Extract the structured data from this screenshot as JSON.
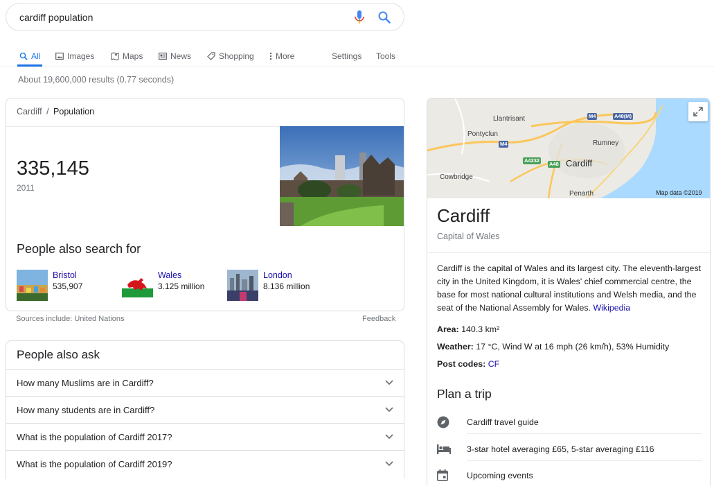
{
  "search": {
    "query": "cardiff population"
  },
  "tabs": {
    "all": "All",
    "images": "Images",
    "maps": "Maps",
    "news": "News",
    "shopping": "Shopping",
    "more": "More",
    "settings": "Settings",
    "tools": "Tools"
  },
  "stats": "About 19,600,000 results (0.77 seconds)",
  "population": {
    "breadcrumb_city": "Cardiff",
    "breadcrumb_sep": "/",
    "breadcrumb_topic": "Population",
    "value": "335,145",
    "year": "2011",
    "people_also_search_title": "People also search for",
    "related": [
      {
        "name": "Bristol",
        "value": "535,907"
      },
      {
        "name": "Wales",
        "value": "3.125 million"
      },
      {
        "name": "London",
        "value": "8.136 million"
      }
    ],
    "sources": "Sources include: United Nations",
    "feedback": "Feedback"
  },
  "people_also_ask": {
    "title": "People also ask",
    "questions": [
      "How many Muslims are in Cardiff?",
      "How many students are in Cardiff?",
      "What is the population of Cardiff 2017?",
      "What is the population of Cardiff 2019?"
    ]
  },
  "knowledge_panel": {
    "map": {
      "labels": [
        "Llantrisant",
        "Pontyclun",
        "Rumney",
        "Cardiff",
        "Cowbridge",
        "Penarth"
      ],
      "roads": [
        "M4",
        "A48(M)",
        "M4",
        "A4232",
        "A48"
      ],
      "attribution": "Map data ©2019"
    },
    "title": "Cardiff",
    "subtitle": "Capital of Wales",
    "description": "Cardiff is the capital of Wales and its largest city. The eleventh-largest city in the United Kingdom, it is Wales' chief commercial centre, the base for most national cultural institutions and Welsh media, and the seat of the National Assembly for Wales.",
    "description_link": "Wikipedia",
    "facts": {
      "area_label": "Area:",
      "area_value": "140.3 km²",
      "weather_label": "Weather:",
      "weather_value": "17 °C, Wind W at 16 mph (26 km/h), 53% Humidity",
      "postcodes_label": "Post codes:",
      "postcodes_value": "CF"
    },
    "plan_title": "Plan a trip",
    "plan_items": [
      "Cardiff travel guide",
      "3-star hotel averaging £65, 5-star averaging £116",
      "Upcoming events"
    ]
  },
  "colors": {
    "link": "#1a0dab",
    "accent": "#1a73e8",
    "muted": "#70757a"
  }
}
